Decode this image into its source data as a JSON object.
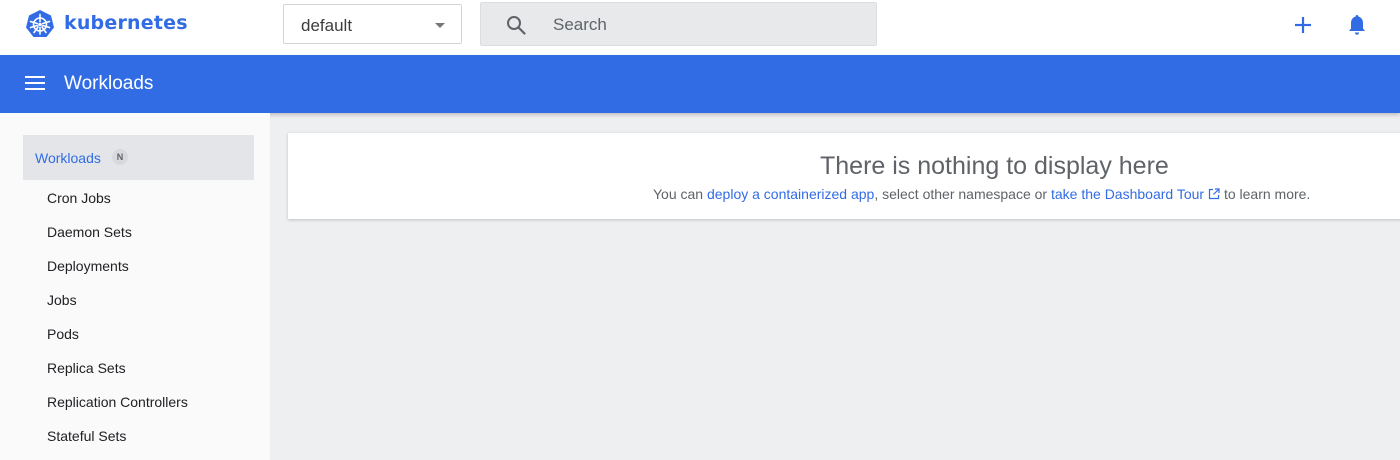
{
  "topbar": {
    "brand": "kubernetes",
    "namespace": {
      "value": "default"
    },
    "search": {
      "placeholder": "Search"
    },
    "icons": [
      "kubernetes-logo-icon",
      "chevron-down-icon",
      "search-icon",
      "plus-icon",
      "bell-icon"
    ]
  },
  "header": {
    "title": "Workloads",
    "menu_icon": "menu-icon"
  },
  "sidebar": {
    "active": {
      "label": "Workloads",
      "badge": "N"
    },
    "items": [
      {
        "label": "Cron Jobs"
      },
      {
        "label": "Daemon Sets"
      },
      {
        "label": "Deployments"
      },
      {
        "label": "Jobs"
      },
      {
        "label": "Pods"
      },
      {
        "label": "Replica Sets"
      },
      {
        "label": "Replication Controllers"
      },
      {
        "label": "Stateful Sets"
      }
    ]
  },
  "empty_state": {
    "title": "There is nothing to display here",
    "text_before": "You can ",
    "link_deploy": "deploy a containerized app",
    "text_middle": ", select other namespace or ",
    "link_tour": "take the Dashboard Tour",
    "text_after": " to learn more."
  },
  "colors": {
    "accent": "#326ce5",
    "background": "#eeeff1",
    "sidebar_active": "#e3e5e8"
  }
}
